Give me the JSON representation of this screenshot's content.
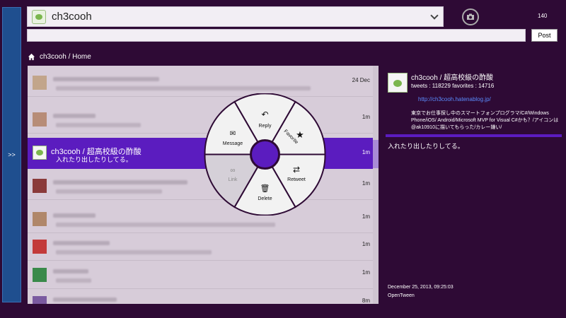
{
  "header": {
    "account_name": "ch3cooh",
    "char_count": "140",
    "post_label": "Post",
    "side_toggle": ">>"
  },
  "breadcrumb": {
    "text": "ch3cooh / Home"
  },
  "timeline": {
    "rows": [
      {
        "time": "24 Dec"
      },
      {
        "time": "1m"
      },
      {
        "name": "ch3cooh / 超高校級の酢酸",
        "text": "入れたり出したりしてる。",
        "time": "1m"
      },
      {
        "time": "1m"
      },
      {
        "time": "1m"
      },
      {
        "time": "1m"
      },
      {
        "time": "1m"
      },
      {
        "time": "8m"
      }
    ]
  },
  "radial_menu": {
    "reply": "Reply",
    "favorite": "Favorite",
    "retweet": "Retweet",
    "delete": "Delete",
    "link": "Link",
    "message": "Message"
  },
  "detail": {
    "name": "ch3cooh / 超高校級の酢酸",
    "stats": "tweets : 118229 favorites : 14716",
    "link": "http://ch3cooh.hatenablog.jp/",
    "bio": "東京でお仕事探し中のスマートフォンプログラマ/C#/Windows Phone/iOS/ Android/Microsoft MVP for Visual C#かも？/アイコンは@ak10910に描いてもらった/カレー嫌い/",
    "tweet": "入れたり出したりしてる。",
    "date": "December 25, 2013, 09:25:03",
    "client": "OpenTween"
  },
  "colors": {
    "background": "#2e0a35",
    "accent": "#5b1cbf",
    "link": "#5a8cff"
  }
}
